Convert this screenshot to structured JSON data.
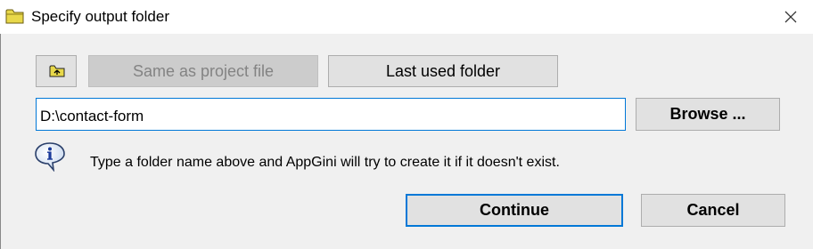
{
  "window": {
    "title": "Specify output folder",
    "icon": "folder-icon",
    "close_icon": "close-icon"
  },
  "toolbar": {
    "up_folder_icon": "folder-up-icon",
    "same_as_project_label": "Same as project file",
    "same_as_project_enabled": false,
    "last_used_label": "Last used folder"
  },
  "path": {
    "value": "D:\\contact-form"
  },
  "browse": {
    "label": "Browse ..."
  },
  "info": {
    "icon": "info-icon",
    "text": "Type a folder name above and AppGini will try to create it if it doesn't exist."
  },
  "actions": {
    "continue_label": "Continue",
    "cancel_label": "Cancel"
  },
  "colors": {
    "accent": "#0078d7",
    "dialog_bg": "#f0f0f0",
    "button_bg": "#e1e1e1",
    "disabled_text": "#838383"
  }
}
